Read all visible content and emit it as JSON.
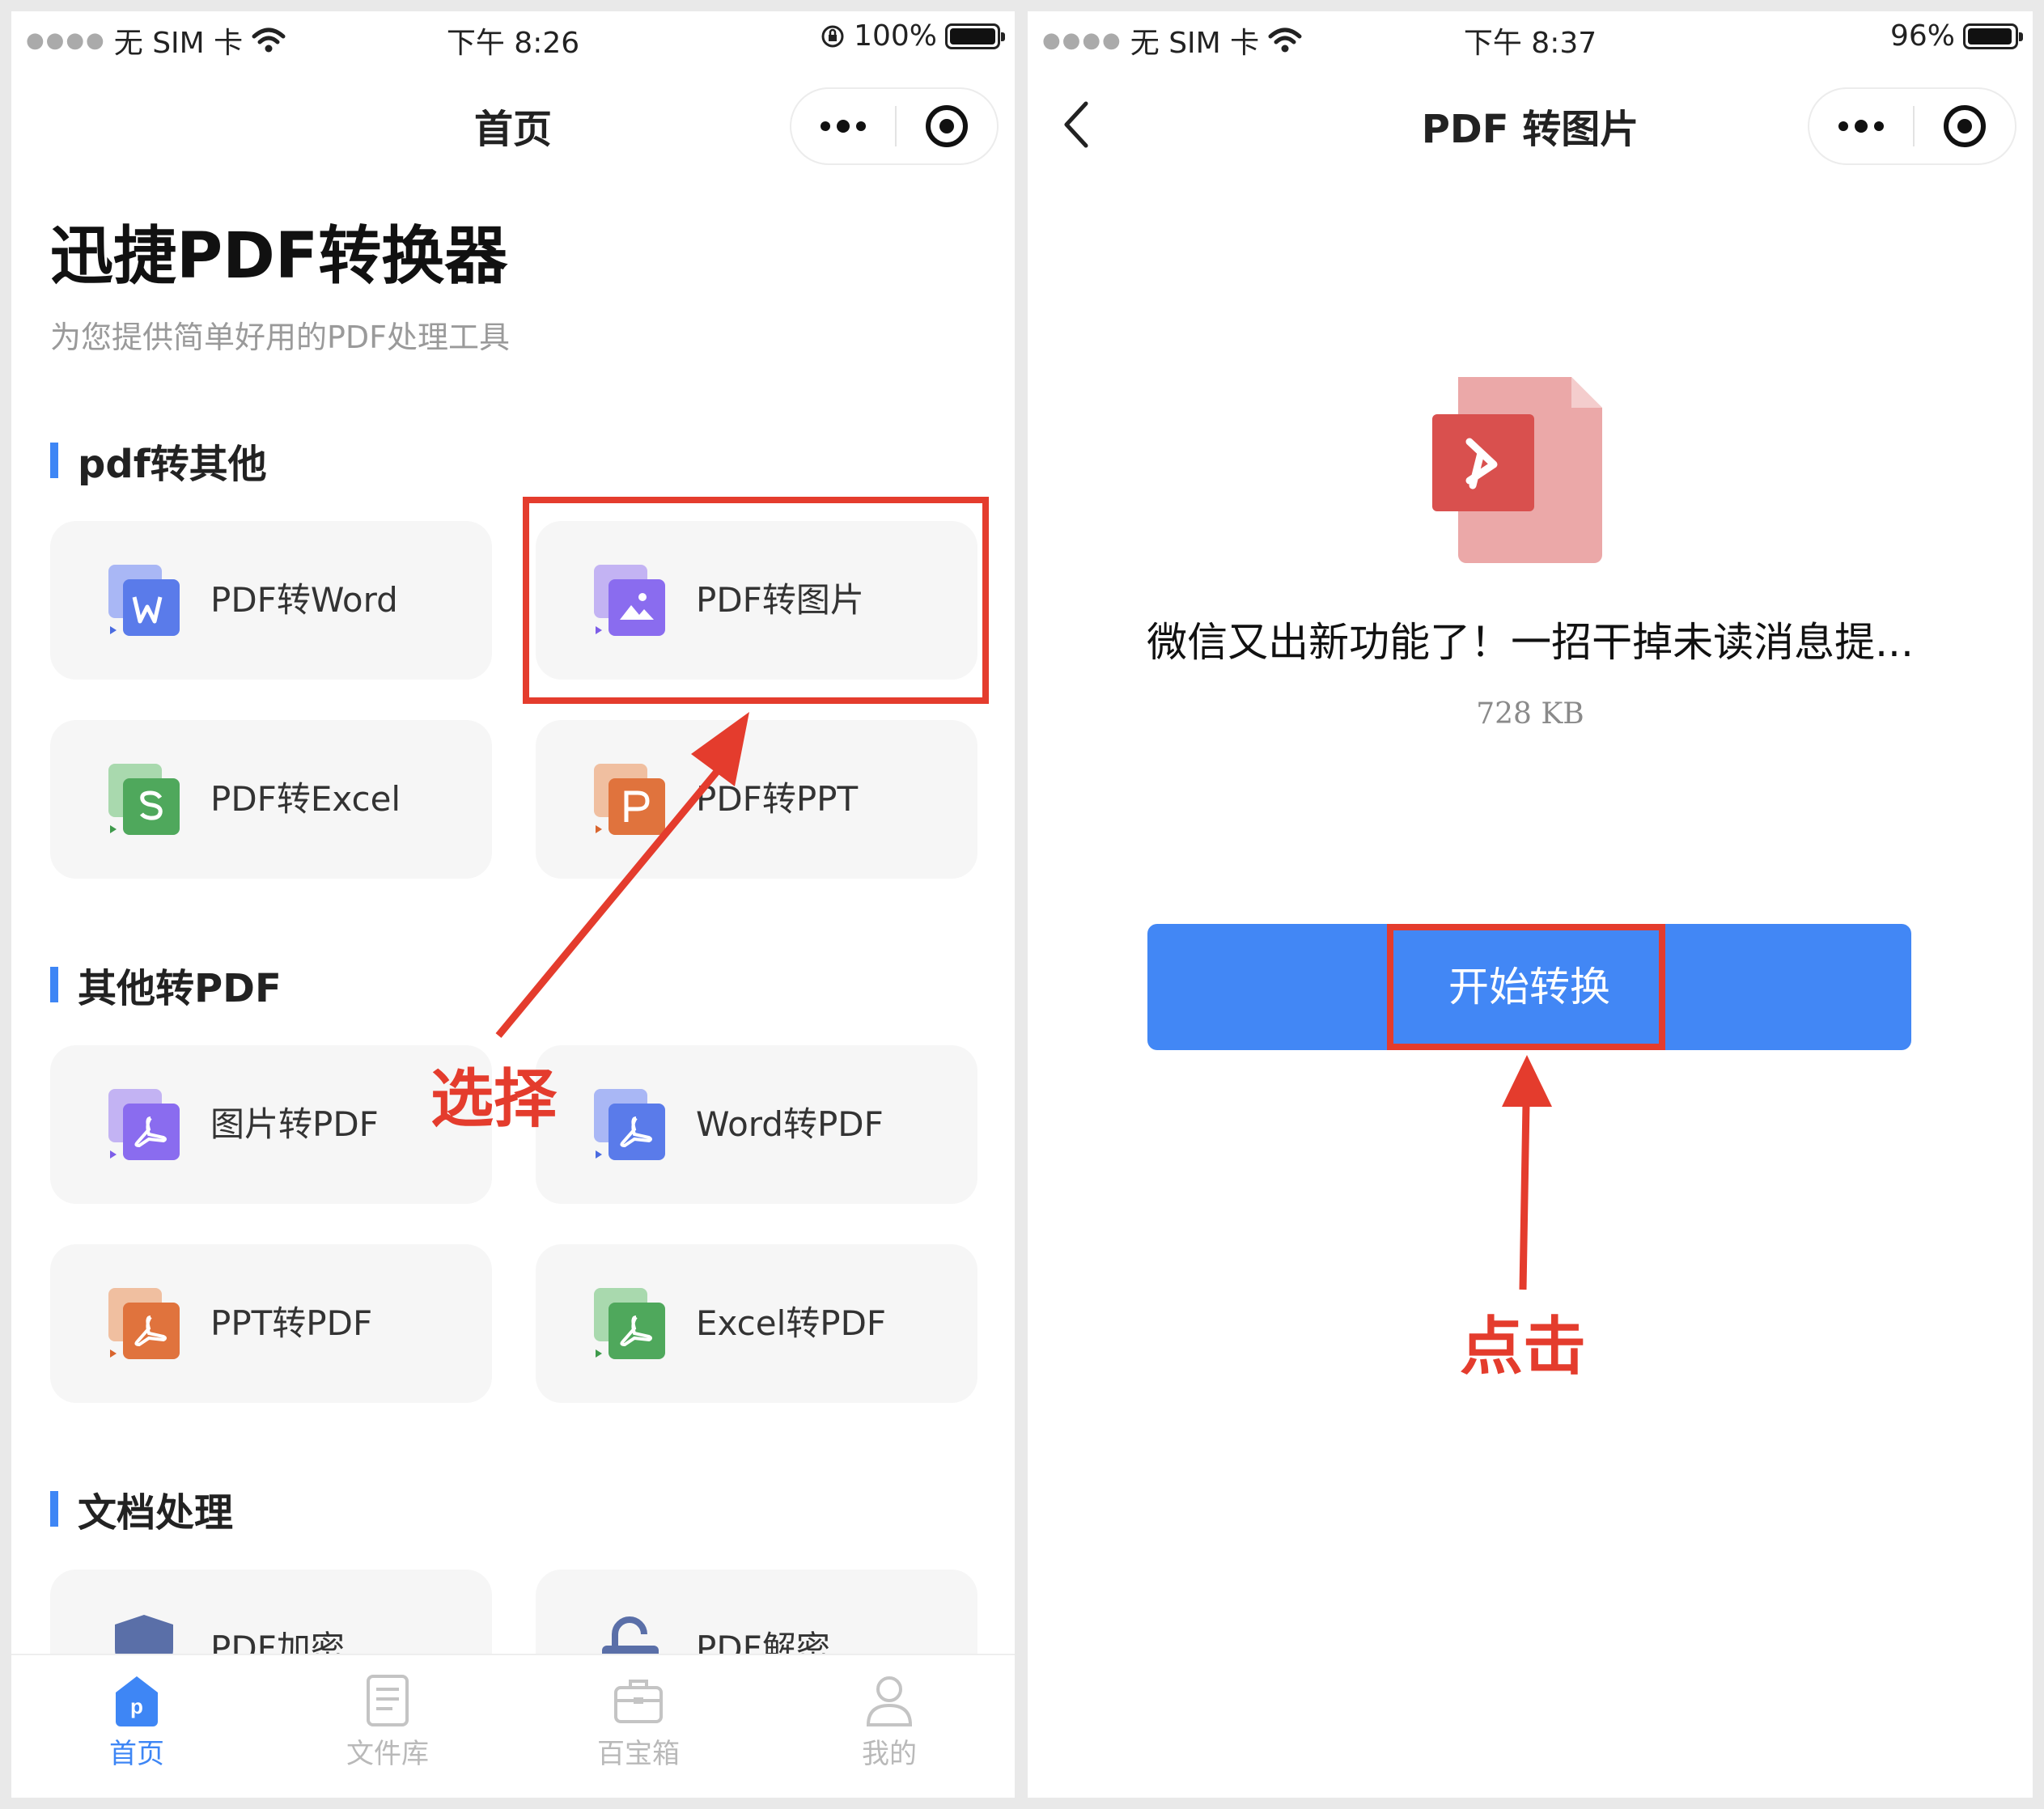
{
  "left": {
    "status": {
      "carrier": "无 SIM 卡",
      "time": "下午 8:26",
      "battery": "100%"
    },
    "nav": {
      "title": "首页"
    },
    "app": {
      "title": "迅捷PDF转换器",
      "subtitle": "为您提供简单好用的PDF处理工具"
    },
    "sections": {
      "pdf_to_other": "pdf转其他",
      "other_to_pdf": "其他转PDF",
      "doc_process": "文档处理"
    },
    "tools": {
      "pdf_word": "PDF转Word",
      "pdf_image": "PDF转图片",
      "pdf_excel": "PDF转Excel",
      "pdf_ppt": "PDF转PPT",
      "image_pdf": "图片转PDF",
      "word_pdf": "Word转PDF",
      "ppt_pdf": "PPT转PDF",
      "excel_pdf": "Excel转PDF",
      "pdf_encrypt": "PDF加密",
      "pdf_decrypt": "PDF解密"
    },
    "tabs": {
      "home": "首页",
      "files": "文件库",
      "toolbox": "百宝箱",
      "mine": "我的"
    },
    "annotation": "选择"
  },
  "right": {
    "status": {
      "carrier": "无 SIM 卡",
      "time": "下午 8:37",
      "battery": "96%"
    },
    "nav": {
      "title": "PDF 转图片"
    },
    "file": {
      "name": "微信又出新功能了！一招干掉未读消息提...",
      "size": "728 KB"
    },
    "start_button": "开始转换",
    "annotation": "点击"
  },
  "colors": {
    "accent": "#3e86f5",
    "annotation_red": "#e43c2d",
    "button_blue": "#4287f5"
  },
  "battery_levels": {
    "left": 1.0,
    "right": 0.96
  }
}
